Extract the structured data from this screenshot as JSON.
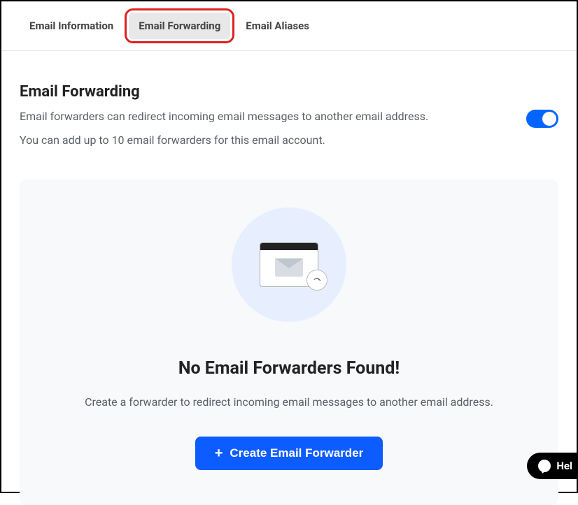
{
  "tabs": {
    "info": "Email Information",
    "forwarding": "Email Forwarding",
    "aliases": "Email Aliases"
  },
  "page": {
    "heading": "Email Forwarding",
    "desc1": "Email forwarders can redirect incoming email messages to another email address.",
    "desc2": "You can add up to 10 email forwarders for this email account."
  },
  "empty": {
    "title": "No Email Forwarders Found!",
    "desc": "Create a forwarder to redirect incoming email messages to another email address.",
    "button": "Create Email Forwarder"
  },
  "help": {
    "label": "Hel"
  }
}
